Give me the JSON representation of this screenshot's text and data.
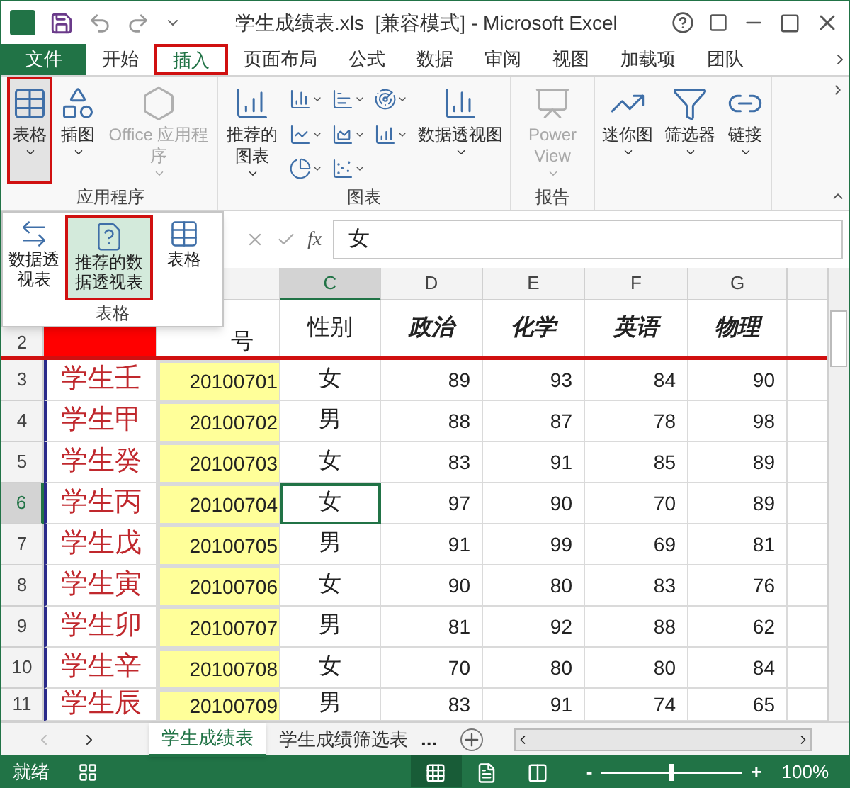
{
  "window": {
    "title": "学生成绩表.xls  [兼容模式] - Microsoft Excel"
  },
  "file_tab": {
    "label": "文件"
  },
  "tabs": [
    {
      "label": "开始",
      "selected": false
    },
    {
      "label": "插入",
      "selected": true
    },
    {
      "label": "页面布局",
      "selected": false
    },
    {
      "label": "公式",
      "selected": false
    },
    {
      "label": "数据",
      "selected": false
    },
    {
      "label": "审阅",
      "selected": false
    },
    {
      "label": "视图",
      "selected": false
    },
    {
      "label": "加载项",
      "selected": false
    },
    {
      "label": "团队",
      "selected": false
    }
  ],
  "ribbon": [
    {
      "kind": "big",
      "label": "表格",
      "pressed": true,
      "disabled": false
    },
    {
      "kind": "big",
      "label": "插图",
      "pressed": false,
      "disabled": false
    },
    {
      "kind": "big",
      "label": "Office 应用程序",
      "pressed": false,
      "disabled": true,
      "group": "应用程序"
    },
    {
      "kind": "big",
      "label": "推荐的图表",
      "pressed": false,
      "disabled": false
    },
    {
      "kind": "charts"
    },
    {
      "kind": "big",
      "label": "数据透视图",
      "pressed": false,
      "disabled": false,
      "group": "图表"
    },
    {
      "kind": "big",
      "label": "Power View",
      "pressed": false,
      "disabled": true,
      "group": "报告"
    },
    {
      "kind": "big",
      "label": "迷你图",
      "pressed": false,
      "disabled": false
    },
    {
      "kind": "big",
      "label": "筛选器",
      "pressed": false,
      "disabled": false
    },
    {
      "kind": "big",
      "label": "链接",
      "pressed": false,
      "disabled": false
    }
  ],
  "dropdown": {
    "items": [
      {
        "label": "数据透视表",
        "selected": false
      },
      {
        "label": "推荐的数据透视表",
        "selected": true
      },
      {
        "label": "表格",
        "selected": false
      }
    ],
    "group_label": "表格"
  },
  "formula_bar": {
    "fx": "fx",
    "value": "女"
  },
  "columns": [
    {
      "label": "C",
      "selected": true
    },
    {
      "label": "D",
      "selected": false
    },
    {
      "label": "E",
      "selected": false
    },
    {
      "label": "F",
      "selected": false
    },
    {
      "label": "G",
      "selected": false
    }
  ],
  "header_row": {
    "row": "2",
    "cells": [
      "号",
      "性别",
      "政治",
      "化学",
      "英语",
      "物理"
    ]
  },
  "rows": [
    {
      "row": "3",
      "selected": false,
      "cells": [
        "学生壬",
        "20100701",
        "女",
        "89",
        "93",
        "84",
        "90"
      ]
    },
    {
      "row": "4",
      "selected": false,
      "cells": [
        "学生甲",
        "20100702",
        "男",
        "88",
        "87",
        "78",
        "98"
      ]
    },
    {
      "row": "5",
      "selected": false,
      "cells": [
        "学生癸",
        "20100703",
        "女",
        "83",
        "91",
        "85",
        "89"
      ]
    },
    {
      "row": "6",
      "selected": true,
      "cells": [
        "学生丙",
        "20100704",
        "女",
        "97",
        "90",
        "70",
        "89"
      ]
    },
    {
      "row": "7",
      "selected": false,
      "cells": [
        "学生戊",
        "20100705",
        "男",
        "91",
        "99",
        "69",
        "81"
      ]
    },
    {
      "row": "8",
      "selected": false,
      "cells": [
        "学生寅",
        "20100706",
        "女",
        "90",
        "80",
        "83",
        "76"
      ]
    },
    {
      "row": "9",
      "selected": false,
      "cells": [
        "学生卯",
        "20100707",
        "男",
        "81",
        "92",
        "88",
        "62"
      ]
    },
    {
      "row": "10",
      "selected": false,
      "cells": [
        "学生辛",
        "20100708",
        "女",
        "70",
        "80",
        "80",
        "84"
      ]
    },
    {
      "row": "11",
      "selected": false,
      "cells": [
        "学生辰",
        "20100709",
        "男",
        "83",
        "91",
        "74",
        "65"
      ]
    }
  ],
  "sheet_tabs": [
    {
      "label": "学生成绩表",
      "selected": true
    },
    {
      "label": "学生成绩筛选表",
      "selected": false
    }
  ],
  "sheet_more": "...",
  "status_bar": {
    "status": "就绪",
    "views": [
      {
        "kind": "normal",
        "selected": true
      },
      {
        "kind": "layout",
        "selected": false
      },
      {
        "kind": "pagebreak",
        "selected": false
      }
    ],
    "zoom": {
      "minus": "-",
      "plus": "+",
      "level": 0.5,
      "reading": "100%"
    }
  }
}
